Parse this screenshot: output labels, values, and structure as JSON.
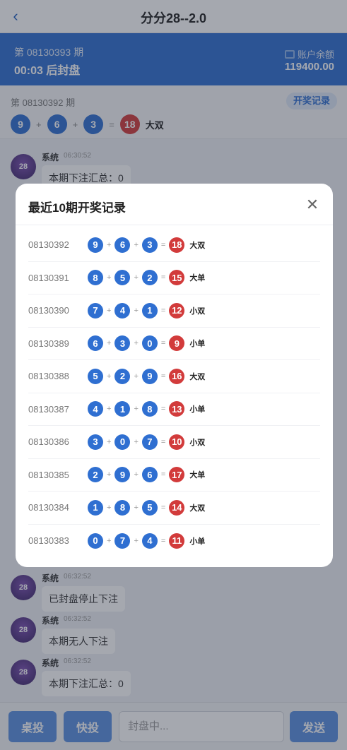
{
  "header": {
    "back_icon": "chevron-left-icon",
    "back_glyph": "‹",
    "title": "分分28--2.0"
  },
  "banner": {
    "period": "第 08130393 期",
    "countdown": "00:03 后封盘",
    "balance_label": "账户余额",
    "balance_value": "119400.00"
  },
  "last_draw": {
    "period": "第 08130392 期",
    "history_button": "开奖记录",
    "balls": [
      "9",
      "6",
      "3"
    ],
    "plus": "+",
    "equals": "=",
    "sum": "18",
    "result": "大双"
  },
  "chat": {
    "messages": [
      {
        "name": "系统",
        "time": "06:30:52",
        "text": "本期下注汇总：0"
      },
      {
        "name": "系统",
        "time": "06:32:52",
        "text": "已封盘停止下注"
      },
      {
        "name": "系统",
        "time": "06:32:52",
        "text": "本期无人下注"
      },
      {
        "name": "系统",
        "time": "06:32:52",
        "text": "本期下注汇总：0"
      }
    ],
    "avatar_text": "28"
  },
  "bottom": {
    "btn1": "桌投",
    "btn2": "快投",
    "input_placeholder": "封盘中...",
    "send": "发送"
  },
  "modal": {
    "title": "最近10期开奖记录",
    "close_glyph": "✕",
    "rows": [
      {
        "period": "08130392",
        "a": "9",
        "b": "6",
        "c": "3",
        "sum": "18",
        "result": "大双"
      },
      {
        "period": "08130391",
        "a": "8",
        "b": "5",
        "c": "2",
        "sum": "15",
        "result": "大单"
      },
      {
        "period": "08130390",
        "a": "7",
        "b": "4",
        "c": "1",
        "sum": "12",
        "result": "小双"
      },
      {
        "period": "08130389",
        "a": "6",
        "b": "3",
        "c": "0",
        "sum": "9",
        "result": "小单"
      },
      {
        "period": "08130388",
        "a": "5",
        "b": "2",
        "c": "9",
        "sum": "16",
        "result": "大双"
      },
      {
        "period": "08130387",
        "a": "4",
        "b": "1",
        "c": "8",
        "sum": "13",
        "result": "小单"
      },
      {
        "period": "08130386",
        "a": "3",
        "b": "0",
        "c": "7",
        "sum": "10",
        "result": "小双"
      },
      {
        "period": "08130385",
        "a": "2",
        "b": "9",
        "c": "6",
        "sum": "17",
        "result": "大单"
      },
      {
        "period": "08130384",
        "a": "1",
        "b": "8",
        "c": "5",
        "sum": "14",
        "result": "大双"
      },
      {
        "period": "08130383",
        "a": "0",
        "b": "7",
        "c": "4",
        "sum": "11",
        "result": "小单"
      }
    ]
  },
  "colors": {
    "primary": "#2f6fd1",
    "ball_blue": "#2f6fd1",
    "ball_red": "#d23b3b"
  }
}
